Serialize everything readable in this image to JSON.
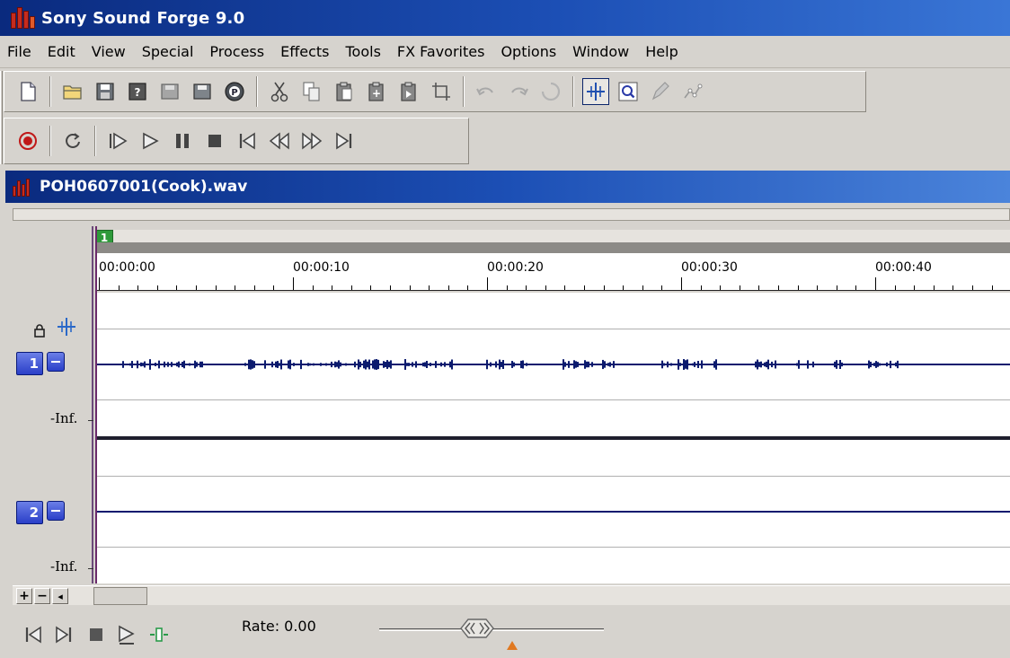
{
  "app": {
    "title": "Sony Sound Forge 9.0"
  },
  "menu": [
    "File",
    "Edit",
    "View",
    "Special",
    "Process",
    "Effects",
    "Tools",
    "FX Favorites",
    "Options",
    "Window",
    "Help"
  ],
  "toolbar_standard": [
    "new-icon",
    "open-icon",
    "save-icon",
    "save-as-icon",
    "save-all-icon",
    "render-icon",
    "properties-icon",
    "cut-icon",
    "copy-icon",
    "paste-icon",
    "paste-new-icon",
    "mix-icon",
    "crop-icon",
    "undo-icon",
    "redo-icon",
    "repeat-icon",
    "edit-tool-icon",
    "magnify-tool-icon",
    "pencil-tool-icon",
    "envelope-tool-icon"
  ],
  "toolbar_transport": [
    "record-icon",
    "loop-icon",
    "play-all-icon",
    "play-icon",
    "pause-icon",
    "stop-icon",
    "go-to-start-icon",
    "rewind-icon",
    "forward-icon",
    "go-to-end-icon"
  ],
  "document": {
    "title": "POH0607001(Cook).wav",
    "marker_label": "1",
    "ruler_labels": [
      "00:00:00",
      "00:00:10",
      "00:00:20",
      "00:00:30",
      "00:00:40"
    ],
    "channels": [
      {
        "number": "1",
        "level_label": "-Inf."
      },
      {
        "number": "2",
        "level_label": "-Inf."
      }
    ]
  },
  "scroll_buttons": [
    "+",
    "−",
    "◂"
  ],
  "transport_bar": {
    "rate_label": "Rate: 0.00",
    "rate_value": 0.0
  },
  "colors": {
    "title_bar": "#0a2a7e",
    "waveform": "#0b1a6e",
    "channel_button": "#2a3fc8",
    "marker": "#2e9a3a"
  }
}
